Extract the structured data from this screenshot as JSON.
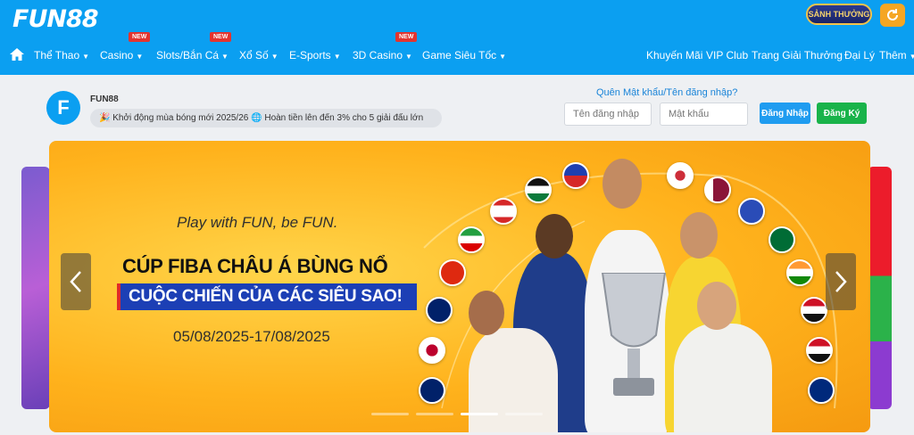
{
  "header": {
    "logo": "FUN88",
    "reward_badge": "SẢNH THƯỞNG",
    "nav": [
      {
        "label": "Thể Thao",
        "new": false
      },
      {
        "label": "Casino",
        "new": true
      },
      {
        "label": "Slots/Bắn Cá",
        "new": true
      },
      {
        "label": "Xổ Số",
        "new": false
      },
      {
        "label": "E-Sports",
        "new": false
      },
      {
        "label": "3D Casino",
        "new": true
      },
      {
        "label": "Game Siêu Tốc",
        "new": false
      }
    ],
    "new_label": "NEW",
    "nav_right": [
      "Khuyến Mãi",
      "VIP Club",
      "Trang Giải Thưởng",
      "Đại Lý",
      "Thêm"
    ]
  },
  "member": {
    "brand_name": "FUN88",
    "marquee": "🎉 Khởi động mùa bóng mới 2025/26  🌐 Hoàn tiền lên đến 3% cho 5 giải đấu lớn",
    "forgot_link": "Quên Mật khẩu/Tên đăng nhập?",
    "username_placeholder": "Tên đăng nhập",
    "password_placeholder": "Mật khẩu",
    "login_label": "Đăng Nhập",
    "register_label": "Đăng Ký"
  },
  "banner": {
    "tagline": "Play with FUN, be FUN.",
    "headline1": "CÚP FIBA CHÂU Á BÙNG NỔ",
    "headline2": "CUỘC CHIẾN CỦA CÁC SIÊU SAO!",
    "dates": "05/08/2025-17/08/2025",
    "slides_count": 4,
    "active_slide": 3
  },
  "colors": {
    "header_bg": "#0b9ff1",
    "login_btn": "#1f9cf0",
    "register_btn": "#19b34a",
    "banner_bg": "#ffb21c"
  }
}
